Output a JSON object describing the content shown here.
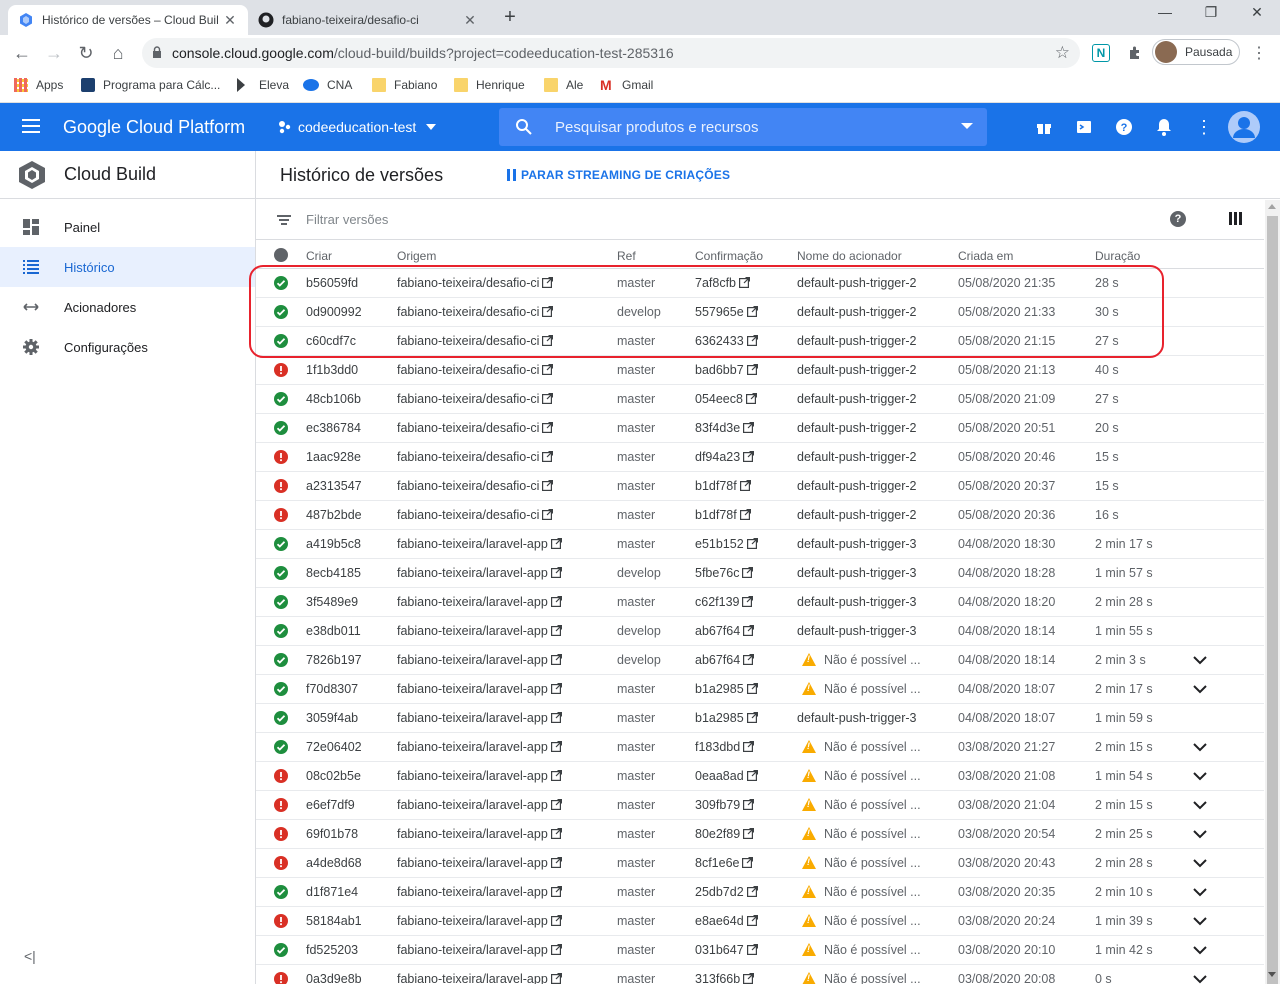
{
  "browser": {
    "tabs": [
      {
        "title": "Histórico de versões – Cloud Buil",
        "icon": "cloud-build-icon",
        "active": true
      },
      {
        "title": "fabiano-teixeira/desafio-ci",
        "icon": "github-icon",
        "active": false
      }
    ],
    "new_tab": "+",
    "url_host": "console.cloud.google.com",
    "url_path": "/cloud-build/builds?project=codeeducation-test-285316",
    "profile_label": "Pausada",
    "ext_n": "N",
    "bookmarks": [
      {
        "label": "Apps",
        "icon": "apps-grid-icon"
      },
      {
        "label": "Programa para Cálc...",
        "icon": "receita-icon"
      },
      {
        "label": "Eleva",
        "icon": "eleva-icon"
      },
      {
        "label": "CNA",
        "icon": "cna-icon"
      },
      {
        "label": "Fabiano",
        "icon": "folder-icon"
      },
      {
        "label": "Henrique",
        "icon": "folder-icon"
      },
      {
        "label": "Ale",
        "icon": "folder-icon"
      },
      {
        "label": "Gmail",
        "icon": "gmail-icon"
      }
    ]
  },
  "gcp": {
    "brand": "Google Cloud Platform",
    "project": "codeeducation-test",
    "search_placeholder": "Pesquisar produtos e recursos",
    "accent": "#1a73e8"
  },
  "sidebar": {
    "product": "Cloud Build",
    "items": [
      {
        "label": "Painel",
        "icon": "dashboard-icon"
      },
      {
        "label": "Histórico",
        "icon": "list-icon",
        "active": true
      },
      {
        "label": "Acionadores",
        "icon": "arrows-icon"
      },
      {
        "label": "Configurações",
        "icon": "gear-icon"
      }
    ],
    "collapse": "<|"
  },
  "page": {
    "title": "Histórico de versões",
    "stream_button": "PARAR STREAMING DE CRIAÇÕES",
    "filter_placeholder": "Filtrar versões",
    "help": "?",
    "columns": {
      "build": "Criar",
      "source": "Origem",
      "ref": "Ref",
      "commit": "Confirmação",
      "trigger": "Nome do acionador",
      "created": "Criada em",
      "duration": "Duração"
    }
  },
  "builds": [
    {
      "status": "ok",
      "id": "b56059fd",
      "source": "fabiano-teixeira/desafio-ci",
      "ref": "master",
      "commit": "7af8cfb",
      "trigger": "default-push-trigger-2",
      "warn": false,
      "created": "05/08/2020 21:35",
      "duration": "28 s",
      "expand": false
    },
    {
      "status": "ok",
      "id": "0d900992",
      "source": "fabiano-teixeira/desafio-ci",
      "ref": "develop",
      "commit": "557965e",
      "trigger": "default-push-trigger-2",
      "warn": false,
      "created": "05/08/2020 21:33",
      "duration": "30 s",
      "expand": false
    },
    {
      "status": "ok",
      "id": "c60cdf7c",
      "source": "fabiano-teixeira/desafio-ci",
      "ref": "master",
      "commit": "6362433",
      "trigger": "default-push-trigger-2",
      "warn": false,
      "created": "05/08/2020 21:15",
      "duration": "27 s",
      "expand": false
    },
    {
      "status": "err",
      "id": "1f1b3dd0",
      "source": "fabiano-teixeira/desafio-ci",
      "ref": "master",
      "commit": "bad6bb7",
      "trigger": "default-push-trigger-2",
      "warn": false,
      "created": "05/08/2020 21:13",
      "duration": "40 s",
      "expand": false
    },
    {
      "status": "ok",
      "id": "48cb106b",
      "source": "fabiano-teixeira/desafio-ci",
      "ref": "master",
      "commit": "054eec8",
      "trigger": "default-push-trigger-2",
      "warn": false,
      "created": "05/08/2020 21:09",
      "duration": "27 s",
      "expand": false
    },
    {
      "status": "ok",
      "id": "ec386784",
      "source": "fabiano-teixeira/desafio-ci",
      "ref": "master",
      "commit": "83f4d3e",
      "trigger": "default-push-trigger-2",
      "warn": false,
      "created": "05/08/2020 20:51",
      "duration": "20 s",
      "expand": false
    },
    {
      "status": "err",
      "id": "1aac928e",
      "source": "fabiano-teixeira/desafio-ci",
      "ref": "master",
      "commit": "df94a23",
      "trigger": "default-push-trigger-2",
      "warn": false,
      "created": "05/08/2020 20:46",
      "duration": "15 s",
      "expand": false
    },
    {
      "status": "err",
      "id": "a2313547",
      "source": "fabiano-teixeira/desafio-ci",
      "ref": "master",
      "commit": "b1df78f",
      "trigger": "default-push-trigger-2",
      "warn": false,
      "created": "05/08/2020 20:37",
      "duration": "15 s",
      "expand": false
    },
    {
      "status": "err",
      "id": "487b2bde",
      "source": "fabiano-teixeira/desafio-ci",
      "ref": "master",
      "commit": "b1df78f",
      "trigger": "default-push-trigger-2",
      "warn": false,
      "created": "05/08/2020 20:36",
      "duration": "16 s",
      "expand": false
    },
    {
      "status": "ok",
      "id": "a419b5c8",
      "source": "fabiano-teixeira/laravel-app",
      "ref": "master",
      "commit": "e51b152",
      "trigger": "default-push-trigger-3",
      "warn": false,
      "created": "04/08/2020 18:30",
      "duration": "2 min 17 s",
      "expand": false
    },
    {
      "status": "ok",
      "id": "8ecb4185",
      "source": "fabiano-teixeira/laravel-app",
      "ref": "develop",
      "commit": "5fbe76c",
      "trigger": "default-push-trigger-3",
      "warn": false,
      "created": "04/08/2020 18:28",
      "duration": "1 min 57 s",
      "expand": false
    },
    {
      "status": "ok",
      "id": "3f5489e9",
      "source": "fabiano-teixeira/laravel-app",
      "ref": "master",
      "commit": "c62f139",
      "trigger": "default-push-trigger-3",
      "warn": false,
      "created": "04/08/2020 18:20",
      "duration": "2 min 28 s",
      "expand": false
    },
    {
      "status": "ok",
      "id": "e38db011",
      "source": "fabiano-teixeira/laravel-app",
      "ref": "develop",
      "commit": "ab67f64",
      "trigger": "default-push-trigger-3",
      "warn": false,
      "created": "04/08/2020 18:14",
      "duration": "1 min 55 s",
      "expand": false
    },
    {
      "status": "ok",
      "id": "7826b197",
      "source": "fabiano-teixeira/laravel-app",
      "ref": "develop",
      "commit": "ab67f64",
      "trigger": "Não é possível ...",
      "warn": true,
      "created": "04/08/2020 18:14",
      "duration": "2 min 3 s",
      "expand": true
    },
    {
      "status": "ok",
      "id": "f70d8307",
      "source": "fabiano-teixeira/laravel-app",
      "ref": "master",
      "commit": "b1a2985",
      "trigger": "Não é possível ...",
      "warn": true,
      "created": "04/08/2020 18:07",
      "duration": "2 min 17 s",
      "expand": true
    },
    {
      "status": "ok",
      "id": "3059f4ab",
      "source": "fabiano-teixeira/laravel-app",
      "ref": "master",
      "commit": "b1a2985",
      "trigger": "default-push-trigger-3",
      "warn": false,
      "created": "04/08/2020 18:07",
      "duration": "1 min 59 s",
      "expand": false
    },
    {
      "status": "ok",
      "id": "72e06402",
      "source": "fabiano-teixeira/laravel-app",
      "ref": "master",
      "commit": "f183dbd",
      "trigger": "Não é possível ...",
      "warn": true,
      "created": "03/08/2020 21:27",
      "duration": "2 min 15 s",
      "expand": true
    },
    {
      "status": "err",
      "id": "08c02b5e",
      "source": "fabiano-teixeira/laravel-app",
      "ref": "master",
      "commit": "0eaa8ad",
      "trigger": "Não é possível ...",
      "warn": true,
      "created": "03/08/2020 21:08",
      "duration": "1 min 54 s",
      "expand": true
    },
    {
      "status": "err",
      "id": "e6ef7df9",
      "source": "fabiano-teixeira/laravel-app",
      "ref": "master",
      "commit": "309fb79",
      "trigger": "Não é possível ...",
      "warn": true,
      "created": "03/08/2020 21:04",
      "duration": "2 min 15 s",
      "expand": true
    },
    {
      "status": "err",
      "id": "69f01b78",
      "source": "fabiano-teixeira/laravel-app",
      "ref": "master",
      "commit": "80e2f89",
      "trigger": "Não é possível ...",
      "warn": true,
      "created": "03/08/2020 20:54",
      "duration": "2 min 25 s",
      "expand": true
    },
    {
      "status": "err",
      "id": "a4de8d68",
      "source": "fabiano-teixeira/laravel-app",
      "ref": "master",
      "commit": "8cf1e6e",
      "trigger": "Não é possível ...",
      "warn": true,
      "created": "03/08/2020 20:43",
      "duration": "2 min 28 s",
      "expand": true
    },
    {
      "status": "ok",
      "id": "d1f871e4",
      "source": "fabiano-teixeira/laravel-app",
      "ref": "master",
      "commit": "25db7d2",
      "trigger": "Não é possível ...",
      "warn": true,
      "created": "03/08/2020 20:35",
      "duration": "2 min 10 s",
      "expand": true
    },
    {
      "status": "err",
      "id": "58184ab1",
      "source": "fabiano-teixeira/laravel-app",
      "ref": "master",
      "commit": "e8ae64d",
      "trigger": "Não é possível ...",
      "warn": true,
      "created": "03/08/2020 20:24",
      "duration": "1 min 39 s",
      "expand": true
    },
    {
      "status": "ok",
      "id": "fd525203",
      "source": "fabiano-teixeira/laravel-app",
      "ref": "master",
      "commit": "031b647",
      "trigger": "Não é possível ...",
      "warn": true,
      "created": "03/08/2020 20:10",
      "duration": "1 min 42 s",
      "expand": true
    },
    {
      "status": "err",
      "id": "0a3d9e8b",
      "source": "fabiano-teixeira/laravel-app",
      "ref": "master",
      "commit": "313f66b",
      "trigger": "Não é possível ...",
      "warn": true,
      "created": "03/08/2020 20:08",
      "duration": "0 s",
      "expand": true
    }
  ]
}
